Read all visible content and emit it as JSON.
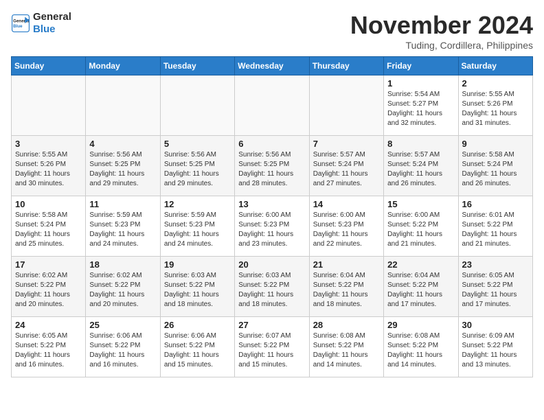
{
  "header": {
    "logo_line1": "General",
    "logo_line2": "Blue",
    "month": "November 2024",
    "location": "Tuding, Cordillera, Philippines"
  },
  "weekdays": [
    "Sunday",
    "Monday",
    "Tuesday",
    "Wednesday",
    "Thursday",
    "Friday",
    "Saturday"
  ],
  "weeks": [
    [
      {
        "day": "",
        "info": ""
      },
      {
        "day": "",
        "info": ""
      },
      {
        "day": "",
        "info": ""
      },
      {
        "day": "",
        "info": ""
      },
      {
        "day": "",
        "info": ""
      },
      {
        "day": "1",
        "info": "Sunrise: 5:54 AM\nSunset: 5:27 PM\nDaylight: 11 hours\nand 32 minutes."
      },
      {
        "day": "2",
        "info": "Sunrise: 5:55 AM\nSunset: 5:26 PM\nDaylight: 11 hours\nand 31 minutes."
      }
    ],
    [
      {
        "day": "3",
        "info": "Sunrise: 5:55 AM\nSunset: 5:26 PM\nDaylight: 11 hours\nand 30 minutes."
      },
      {
        "day": "4",
        "info": "Sunrise: 5:56 AM\nSunset: 5:25 PM\nDaylight: 11 hours\nand 29 minutes."
      },
      {
        "day": "5",
        "info": "Sunrise: 5:56 AM\nSunset: 5:25 PM\nDaylight: 11 hours\nand 29 minutes."
      },
      {
        "day": "6",
        "info": "Sunrise: 5:56 AM\nSunset: 5:25 PM\nDaylight: 11 hours\nand 28 minutes."
      },
      {
        "day": "7",
        "info": "Sunrise: 5:57 AM\nSunset: 5:24 PM\nDaylight: 11 hours\nand 27 minutes."
      },
      {
        "day": "8",
        "info": "Sunrise: 5:57 AM\nSunset: 5:24 PM\nDaylight: 11 hours\nand 26 minutes."
      },
      {
        "day": "9",
        "info": "Sunrise: 5:58 AM\nSunset: 5:24 PM\nDaylight: 11 hours\nand 26 minutes."
      }
    ],
    [
      {
        "day": "10",
        "info": "Sunrise: 5:58 AM\nSunset: 5:24 PM\nDaylight: 11 hours\nand 25 minutes."
      },
      {
        "day": "11",
        "info": "Sunrise: 5:59 AM\nSunset: 5:23 PM\nDaylight: 11 hours\nand 24 minutes."
      },
      {
        "day": "12",
        "info": "Sunrise: 5:59 AM\nSunset: 5:23 PM\nDaylight: 11 hours\nand 24 minutes."
      },
      {
        "day": "13",
        "info": "Sunrise: 6:00 AM\nSunset: 5:23 PM\nDaylight: 11 hours\nand 23 minutes."
      },
      {
        "day": "14",
        "info": "Sunrise: 6:00 AM\nSunset: 5:23 PM\nDaylight: 11 hours\nand 22 minutes."
      },
      {
        "day": "15",
        "info": "Sunrise: 6:00 AM\nSunset: 5:22 PM\nDaylight: 11 hours\nand 21 minutes."
      },
      {
        "day": "16",
        "info": "Sunrise: 6:01 AM\nSunset: 5:22 PM\nDaylight: 11 hours\nand 21 minutes."
      }
    ],
    [
      {
        "day": "17",
        "info": "Sunrise: 6:02 AM\nSunset: 5:22 PM\nDaylight: 11 hours\nand 20 minutes."
      },
      {
        "day": "18",
        "info": "Sunrise: 6:02 AM\nSunset: 5:22 PM\nDaylight: 11 hours\nand 20 minutes."
      },
      {
        "day": "19",
        "info": "Sunrise: 6:03 AM\nSunset: 5:22 PM\nDaylight: 11 hours\nand 18 minutes."
      },
      {
        "day": "20",
        "info": "Sunrise: 6:03 AM\nSunset: 5:22 PM\nDaylight: 11 hours\nand 18 minutes."
      },
      {
        "day": "21",
        "info": "Sunrise: 6:04 AM\nSunset: 5:22 PM\nDaylight: 11 hours\nand 18 minutes."
      },
      {
        "day": "22",
        "info": "Sunrise: 6:04 AM\nSunset: 5:22 PM\nDaylight: 11 hours\nand 17 minutes."
      },
      {
        "day": "23",
        "info": "Sunrise: 6:05 AM\nSunset: 5:22 PM\nDaylight: 11 hours\nand 17 minutes."
      }
    ],
    [
      {
        "day": "24",
        "info": "Sunrise: 6:05 AM\nSunset: 5:22 PM\nDaylight: 11 hours\nand 16 minutes."
      },
      {
        "day": "25",
        "info": "Sunrise: 6:06 AM\nSunset: 5:22 PM\nDaylight: 11 hours\nand 16 minutes."
      },
      {
        "day": "26",
        "info": "Sunrise: 6:06 AM\nSunset: 5:22 PM\nDaylight: 11 hours\nand 15 minutes."
      },
      {
        "day": "27",
        "info": "Sunrise: 6:07 AM\nSunset: 5:22 PM\nDaylight: 11 hours\nand 15 minutes."
      },
      {
        "day": "28",
        "info": "Sunrise: 6:08 AM\nSunset: 5:22 PM\nDaylight: 11 hours\nand 14 minutes."
      },
      {
        "day": "29",
        "info": "Sunrise: 6:08 AM\nSunset: 5:22 PM\nDaylight: 11 hours\nand 14 minutes."
      },
      {
        "day": "30",
        "info": "Sunrise: 6:09 AM\nSunset: 5:22 PM\nDaylight: 11 hours\nand 13 minutes."
      }
    ]
  ]
}
